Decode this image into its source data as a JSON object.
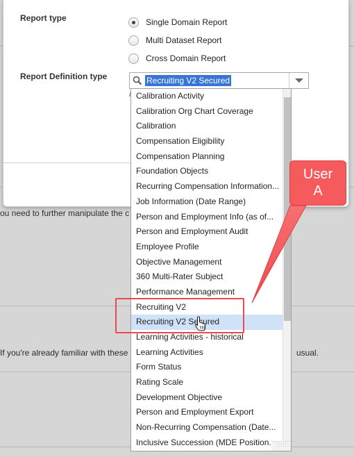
{
  "background": {
    "text_line_1": "ou need to further manipulate the c",
    "text_line_2_left": "If you're already familiar with these",
    "text_line_2_right": "usual."
  },
  "dialog": {
    "report_type_label": "Report type",
    "report_type_options": [
      {
        "label": "Single Domain Report",
        "checked": true
      },
      {
        "label": "Multi Dataset Report",
        "checked": false
      },
      {
        "label": "Cross Domain Report",
        "checked": false
      }
    ],
    "definition_type_label": "Report Definition type",
    "combo": {
      "value": "Recruiting V2 Secured",
      "search_icon": "search-icon",
      "arrow_icon": "chevron-down-icon",
      "stray_text": "/"
    }
  },
  "dropdown": {
    "hovered_index": 15,
    "items": [
      "Calibration Activity",
      "Calibration Org Chart Coverage",
      "Calibration",
      "Compensation Eligibility",
      "Compensation Planning",
      "Foundation Objects",
      "Recurring Compensation Information...",
      "Job Information (Date Range)",
      "Person and Employment Info (as of...",
      "Person and Employment Audit",
      "Employee Profile",
      "Objective Management",
      "360 Multi-Rater Subject",
      "Performance Management",
      "Recruiting V2",
      "Recruiting V2 Secured",
      "Learning Activities - historical",
      "Learning Activities",
      "Form Status",
      "Rating Scale",
      "Development Objective",
      "Person and Employment Export",
      "Non-Recurring Compensation (Date...",
      "Inclusive Succession (MDE Position..."
    ],
    "grip": "::::::"
  },
  "annotation": {
    "text": "User A",
    "color": "#f55a5c"
  },
  "colors": {
    "selection": "#3875d7",
    "hover": "#cfe2f8",
    "accent_red": "#e84a4f"
  }
}
